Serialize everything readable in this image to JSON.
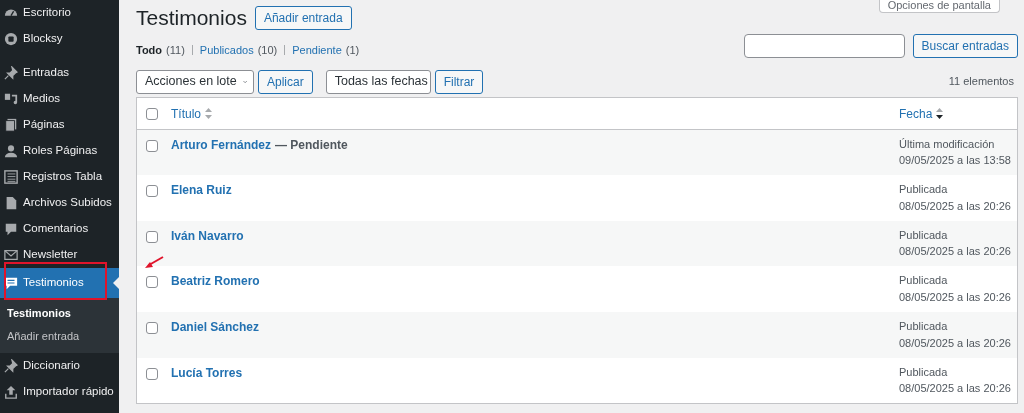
{
  "sidebar": {
    "groups": [
      [
        {
          "label": "Escritorio",
          "selected": false
        },
        {
          "label": "Blocksy",
          "selected": false
        }
      ],
      [
        {
          "label": "Entradas",
          "selected": false
        },
        {
          "label": "Medios",
          "selected": false
        },
        {
          "label": "Páginas",
          "selected": false
        },
        {
          "label": "Roles Páginas",
          "selected": false
        },
        {
          "label": "Registros Tabla",
          "selected": false
        },
        {
          "label": "Archivos Subidos",
          "selected": false
        },
        {
          "label": "Comentarios",
          "selected": false
        },
        {
          "label": "Newsletter",
          "selected": false
        },
        {
          "label": "Testimonios",
          "selected": true,
          "children": [
            {
              "label": "Testimonios",
              "selected": true
            },
            {
              "label": "Añadir entrada",
              "selected": false
            }
          ]
        },
        {
          "label": "Diccionario",
          "selected": false
        },
        {
          "label": "Importador rápido",
          "selected": false
        }
      ]
    ]
  },
  "screen_options": "Opciones de pantalla",
  "page_title": "Testimonios",
  "add_button": "Añadir entrada",
  "filters": [
    {
      "label": "Todo",
      "count": "(11)",
      "selected": true
    },
    {
      "label": "Publicados",
      "count": "(10)",
      "selected": false
    },
    {
      "label": "Pendiente",
      "count": "(1)",
      "selected": false
    }
  ],
  "search": {
    "button": "Buscar entradas"
  },
  "bulk_actions": {
    "value": "Acciones en lote",
    "button": "Aplicar"
  },
  "date_filter": {
    "value": "Todas las fechas",
    "button": "Filtrar"
  },
  "item_count": "11 elementos",
  "table": {
    "select_all": {
      "checked": false
    },
    "columns": [
      "Título",
      "Fecha"
    ],
    "rows": [
      {
        "title": "Arturo Fernández",
        "state": "— Pendiente",
        "checked": false,
        "date_label": "Última modificación",
        "date": "09/05/2025 a las 13:58"
      },
      {
        "title": "Elena Ruiz",
        "checked": false,
        "date_label": "Publicada",
        "date": "08/05/2025 a las 20:26"
      },
      {
        "title": "Iván Navarro",
        "checked": false,
        "date_label": "Publicada",
        "date": "08/05/2025 a las 20:26"
      },
      {
        "title": "Beatriz Romero",
        "checked": false,
        "date_label": "Publicada",
        "date": "08/05/2025 a las 20:26"
      },
      {
        "title": "Daniel Sánchez",
        "checked": false,
        "date_label": "Publicada",
        "date": "08/05/2025 a las 20:26"
      },
      {
        "title": "Lucía Torres",
        "checked": false,
        "date_label": "Publicada",
        "date": "08/05/2025 a las 20:26"
      }
    ]
  }
}
